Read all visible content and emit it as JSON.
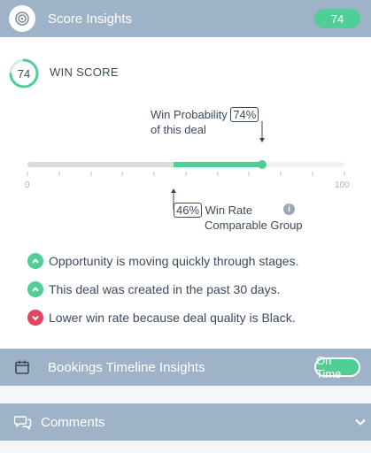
{
  "score_insights": {
    "title": "Score Insights",
    "badge": "74"
  },
  "win_score": {
    "value": "74",
    "title": "WIN SCORE"
  },
  "probability": {
    "label_line1": "Win Probability",
    "label_line2": "of this deal",
    "value_text": "74%",
    "value": 74
  },
  "scale": {
    "min_label": "0",
    "max_label": "100"
  },
  "win_rate": {
    "value_text": "46%",
    "value": 46,
    "label_line1": "Win Rate",
    "label_line2": "Comparable Group"
  },
  "insights": [
    {
      "type": "up",
      "text": "Opportunity is moving quickly through stages."
    },
    {
      "type": "up",
      "text": "This deal was created in the past 30 days."
    },
    {
      "type": "down",
      "text": "Lower win rate because deal quality is Black."
    }
  ],
  "bookings": {
    "title": "Bookings Timeline Insights",
    "badge": "On Time"
  },
  "comments": {
    "title": "Comments"
  },
  "colors": {
    "header": "#9fb3c8",
    "accent": "#4fcf95",
    "negative": "#e0475e",
    "track": "#dcdcdc"
  }
}
